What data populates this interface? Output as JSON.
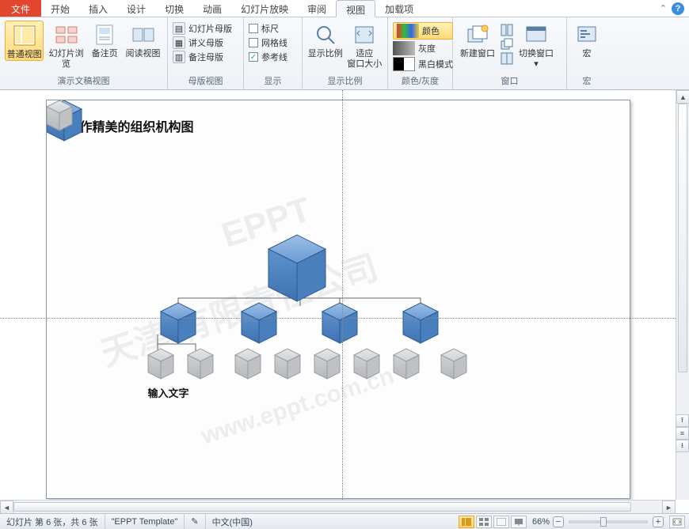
{
  "tabs": {
    "file": "文件",
    "items": [
      "开始",
      "插入",
      "设计",
      "切换",
      "动画",
      "幻灯片放映",
      "审阅",
      "视图",
      "加载项"
    ],
    "active_index": 7
  },
  "ribbon": {
    "group1": {
      "label": "演示文稿视图",
      "normal": "普通视图",
      "browse": "幻灯片浏览",
      "notes": "备注页",
      "reading": "阅读视图"
    },
    "group2": {
      "label": "母版视图",
      "slide_master": "幻灯片母版",
      "handout_master": "讲义母版",
      "notes_master": "备注母版"
    },
    "group3": {
      "label": "显示",
      "ruler": "标尺",
      "grid": "网格线",
      "guides": "参考线"
    },
    "group4": {
      "label": "显示比例",
      "zoom": "显示比例",
      "fit": "适应",
      "fit2": "窗口大小"
    },
    "group5": {
      "label": "颜色/灰度",
      "color": "颜色",
      "gray": "灰度",
      "bw": "黑白模式"
    },
    "group6": {
      "label": "窗口",
      "new_window": "新建窗口",
      "switch": "切换窗口"
    },
    "group7": {
      "label": "宏",
      "macro": "宏"
    }
  },
  "slide": {
    "title": "制作精美的组织机构图",
    "label_text": "输入文字",
    "watermark1": "天津        有限责任公司",
    "watermark2": "EPPT",
    "watermark3": "www.eppt.com.cn"
  },
  "status": {
    "slide_pos": "幻灯片 第 6 张，共 6 张",
    "template": "\"EPPT Template\"",
    "lang": "中文(中国)",
    "zoom": "66%"
  }
}
